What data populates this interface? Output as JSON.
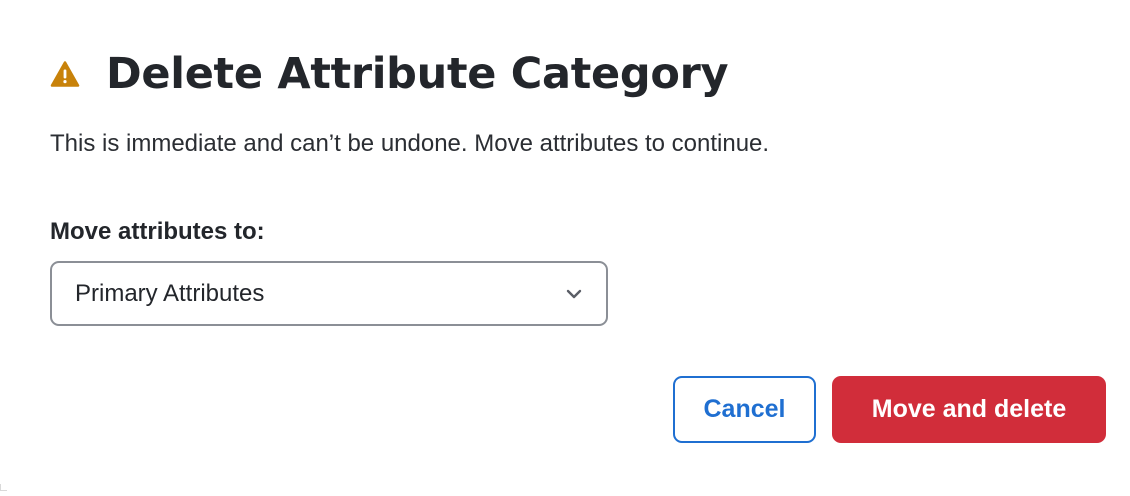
{
  "dialog": {
    "title": "Delete Attribute Category",
    "icon": "warning-icon",
    "description": "This is immediate and can’t be undone. Move attributes to continue.",
    "field": {
      "label": "Move attributes to:",
      "selected_value": "Primary Attributes",
      "icon": "chevron-down-icon"
    },
    "buttons": {
      "cancel_label": "Cancel",
      "confirm_label": "Move and delete"
    }
  },
  "colors": {
    "warning": "#c8820a",
    "primary_outline": "#1f6fd1",
    "danger": "#d12d3a",
    "text": "#23262b",
    "select_border": "#8b8f96"
  }
}
